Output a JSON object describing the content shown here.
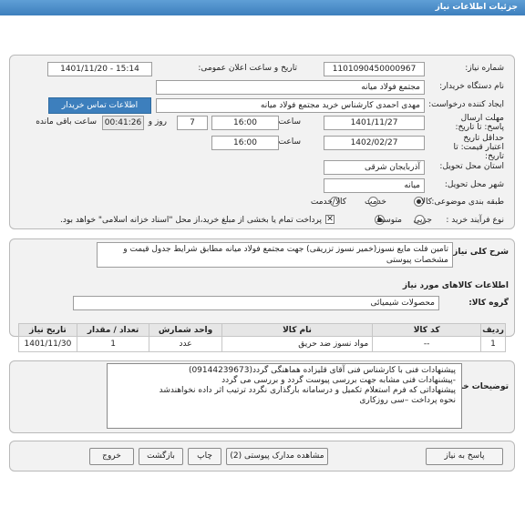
{
  "title": "جزئیات اطلاعات نیاز",
  "need_number": {
    "label": "شماره نیاز:",
    "value": "1101090450000967"
  },
  "announce": {
    "label": "تاریخ و ساعت اعلان عمومی:",
    "value": "1401/11/20 - 15:14"
  },
  "buyer_org": {
    "label": "نام دستگاه خریدار:",
    "value": "مجتمع فولاد میانه"
  },
  "requester": {
    "label": "ایجاد کننده درخواست:",
    "value": "مهدی احمدی کارشناس خرید مجتمع فولاد میانه",
    "contact_link": "اطلاعات تماس خریدار"
  },
  "deadline": {
    "label": "مهلت ارسال پاسخ: تا تاریخ:",
    "date": "1401/11/27",
    "time_label": "ساعت",
    "time": "16:00",
    "days": "7",
    "days_label": "روز و",
    "remaining": "00:41:26",
    "remaining_label": "ساعت باقی مانده"
  },
  "validity": {
    "label": "حداقل تاریخ اعتبار قیمت: تا تاریخ:",
    "date": "1402/02/27",
    "time_label": "ساعت",
    "time": "16:00"
  },
  "province": {
    "label": "استان محل تحویل:",
    "value": "آذربایجان شرقی"
  },
  "city": {
    "label": "شهر محل تحویل:",
    "value": "میانه"
  },
  "category": {
    "label": "طبقه بندی موضوعی:",
    "options": [
      "کالا",
      "خدمت",
      "کالا/خدمت"
    ],
    "selected": "کالا"
  },
  "process": {
    "label": "نوع فرآیند خرید :",
    "options": [
      "جزیی",
      "متوسط"
    ],
    "selected": "متوسط",
    "note": "پرداخت تمام یا بخشی از مبلغ خرید،از محل \"اسناد خزانه اسلامی\" خواهد بود."
  },
  "summary": {
    "label": "شرح کلی نیاز:",
    "value": "تامین فلت مایع نسوز(خمیر نسوز تزریقی)  جهت مجتمع فولاد میانه مطابق شرایط جدول قیمت و مشخصات پیوستی"
  },
  "goods_info_title": "اطلاعات کالاهای مورد نیاز",
  "goods_group": {
    "label": "گروه کالا:",
    "value": "محصولات شیمیائی"
  },
  "table": {
    "headers": [
      "ردیف",
      "کد کالا",
      "نام کالا",
      "واحد شمارش",
      "تعداد / مقدار",
      "تاریخ نیاز"
    ],
    "rows": [
      {
        "row": "1",
        "code": "--",
        "name": "مواد نسوز ضد حریق",
        "unit": "عدد",
        "qty": "1",
        "date": "1401/11/30"
      }
    ]
  },
  "buyer_notes": {
    "label": "توضیحات خریدار:",
    "lines": [
      "پیشنهادات فنی با کارشناس فنی آقای قلیزاده هماهنگی گردد(09144239673)",
      "-پیشنهادات فنی مشابه جهت بررسی پیوست گردد و بررسی می گردد",
      "پیشنهاداتی که فرم استعلام تکمیل و درسامانه بارگذاری نگردد ترتیب اثر داده نخواهندشد",
      "نحوه پرداخت –سی روزکاری"
    ]
  },
  "buttons": {
    "reply": "پاسخ به نیاز",
    "attachments": "مشاهده مدارک پیوستی (2)",
    "print": "چاپ",
    "back": "بازگشت",
    "exit": "خروج"
  }
}
